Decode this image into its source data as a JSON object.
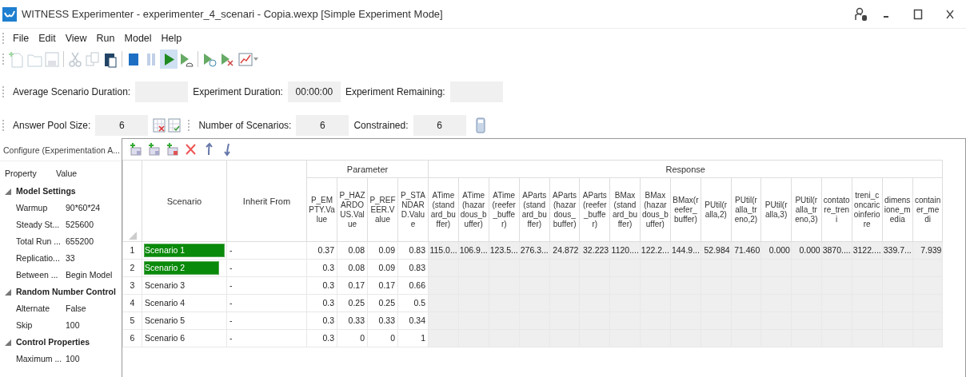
{
  "window": {
    "title": "WITNESS Experimenter - experimenter_4_scenari - Copia.wexp [Simple Experiment Mode]"
  },
  "menu": [
    "File",
    "Edit",
    "View",
    "Run",
    "Model",
    "Help"
  ],
  "toolbar": [
    {
      "kind": "new",
      "disabled": true,
      "selected": false
    },
    {
      "kind": "open",
      "disabled": true,
      "selected": false
    },
    {
      "kind": "save",
      "disabled": true,
      "selected": false
    },
    {
      "kind": "cut",
      "disabled": true,
      "selected": false
    },
    {
      "kind": "copy",
      "disabled": true,
      "selected": false
    },
    {
      "kind": "paste",
      "disabled": false,
      "selected": false
    },
    {
      "kind": "stop",
      "disabled": false,
      "selected": false
    },
    {
      "kind": "pause",
      "disabled": true,
      "selected": false
    },
    {
      "kind": "play",
      "disabled": false,
      "selected": true
    },
    {
      "kind": "step",
      "disabled": false,
      "selected": false
    },
    {
      "kind": "timed",
      "disabled": false,
      "selected": false
    },
    {
      "kind": "fast",
      "disabled": false,
      "selected": false
    },
    {
      "kind": "chart",
      "disabled": false,
      "selected": false
    }
  ],
  "status_row_1": [
    {
      "label": "Average Scenario Duration:"
    },
    {
      "label": "Experiment Duration:",
      "value": "00:00:00"
    },
    {
      "label": "Experiment Remaining:"
    }
  ],
  "status_row_2": [
    {
      "label": "Answer Pool Size:",
      "value": "6"
    },
    {
      "label": "Number of Scenarios:",
      "value": "6"
    },
    {
      "label": "Constrained:",
      "value": "6"
    }
  ],
  "config_panel": {
    "title": "Configure (Experimentation A...",
    "columns": [
      "Property",
      "Value"
    ],
    "groups": [
      {
        "name": "Model Settings",
        "expanded": true,
        "items": [
          {
            "property": "Warmup",
            "value": "90*60*24"
          },
          {
            "property": "Steady St...",
            "value": "525600"
          },
          {
            "property": "Total Run ...",
            "value": "655200"
          },
          {
            "property": "Replicatio...",
            "value": "33"
          },
          {
            "property": "Between ...",
            "value": "Begin Model"
          }
        ]
      },
      {
        "name": "Random Number Control",
        "expanded": true,
        "items": [
          {
            "property": "Alternate",
            "value": "False"
          },
          {
            "property": "Skip",
            "value": "100"
          }
        ]
      },
      {
        "name": "Control Properties",
        "expanded": true,
        "items": [
          {
            "property": "Maximum ...",
            "value": "100"
          }
        ]
      }
    ]
  },
  "grid_toolbar": [
    {
      "kind": "add"
    },
    {
      "kind": "add"
    },
    {
      "kind": "add-red"
    },
    {
      "kind": "delete"
    },
    {
      "kind": "up"
    },
    {
      "kind": "down"
    }
  ],
  "table": {
    "columns": [
      "Scenario",
      "Inherit From"
    ],
    "groups": [
      {
        "label": "Parameter",
        "columns": [
          "P_EMPTY.Value",
          "P_HAZARDOUS.Value",
          "P_REFEER.Value",
          "P_STANDARD.Value"
        ]
      },
      {
        "label": "Response",
        "columns": [
          "ATime(standard_buffer)",
          "ATime(hazardous_buffer)",
          "ATime(reefer_buffer)",
          "AParts(standard_buffer)",
          "AParts(hazardous_buffer)",
          "AParts(reefer_buffer)",
          "BMax(standard_buffer)",
          "BMax(hazardous_buffer)",
          "BMax(reefer_buffer)",
          "PUtil(ralla,2)",
          "PUtil(ralla_treno,2)",
          "PUtil(ralla,3)",
          "PUtil(ralla_treno,3)",
          "contatore_treni",
          "treni_concaricoinferiore",
          "dimensione_media",
          "container_medi"
        ]
      }
    ],
    "rows": [
      {
        "number": "1",
        "scenario": "Scenario 1",
        "level": 1,
        "inherit": "-",
        "parameters": [
          "0.37",
          "0.08",
          "0.09",
          "0.83"
        ],
        "responses": [
          "115.0...",
          "106.9...",
          "123.5...",
          "276.3...",
          "24.872",
          "32.223",
          "1120....",
          "122.2...",
          "144.9...",
          "52.984",
          "71.460",
          "0.000",
          "0.000",
          "3870....",
          "3122....",
          "339.7...",
          "7.939"
        ]
      },
      {
        "number": "2",
        "scenario": "Scenario 2",
        "level": 0.93,
        "inherit": "-",
        "parameters": [
          "0.3",
          "0.08",
          "0.09",
          "0.83"
        ]
      },
      {
        "number": "3",
        "scenario": "Scenario 3",
        "inherit": "-",
        "parameters": [
          "0.3",
          "0.17",
          "0.17",
          "0.66"
        ]
      },
      {
        "number": "4",
        "scenario": "Scenario 4",
        "inherit": "-",
        "parameters": [
          "0.3",
          "0.25",
          "0.25",
          "0.5"
        ]
      },
      {
        "number": "5",
        "scenario": "Scenario 5",
        "inherit": "-",
        "parameters": [
          "0.3",
          "0.33",
          "0.33",
          "0.34"
        ]
      },
      {
        "number": "6",
        "scenario": "Scenario 6",
        "inherit": "-",
        "parameters": [
          "0.3",
          "0",
          "0",
          "1"
        ]
      }
    ]
  }
}
